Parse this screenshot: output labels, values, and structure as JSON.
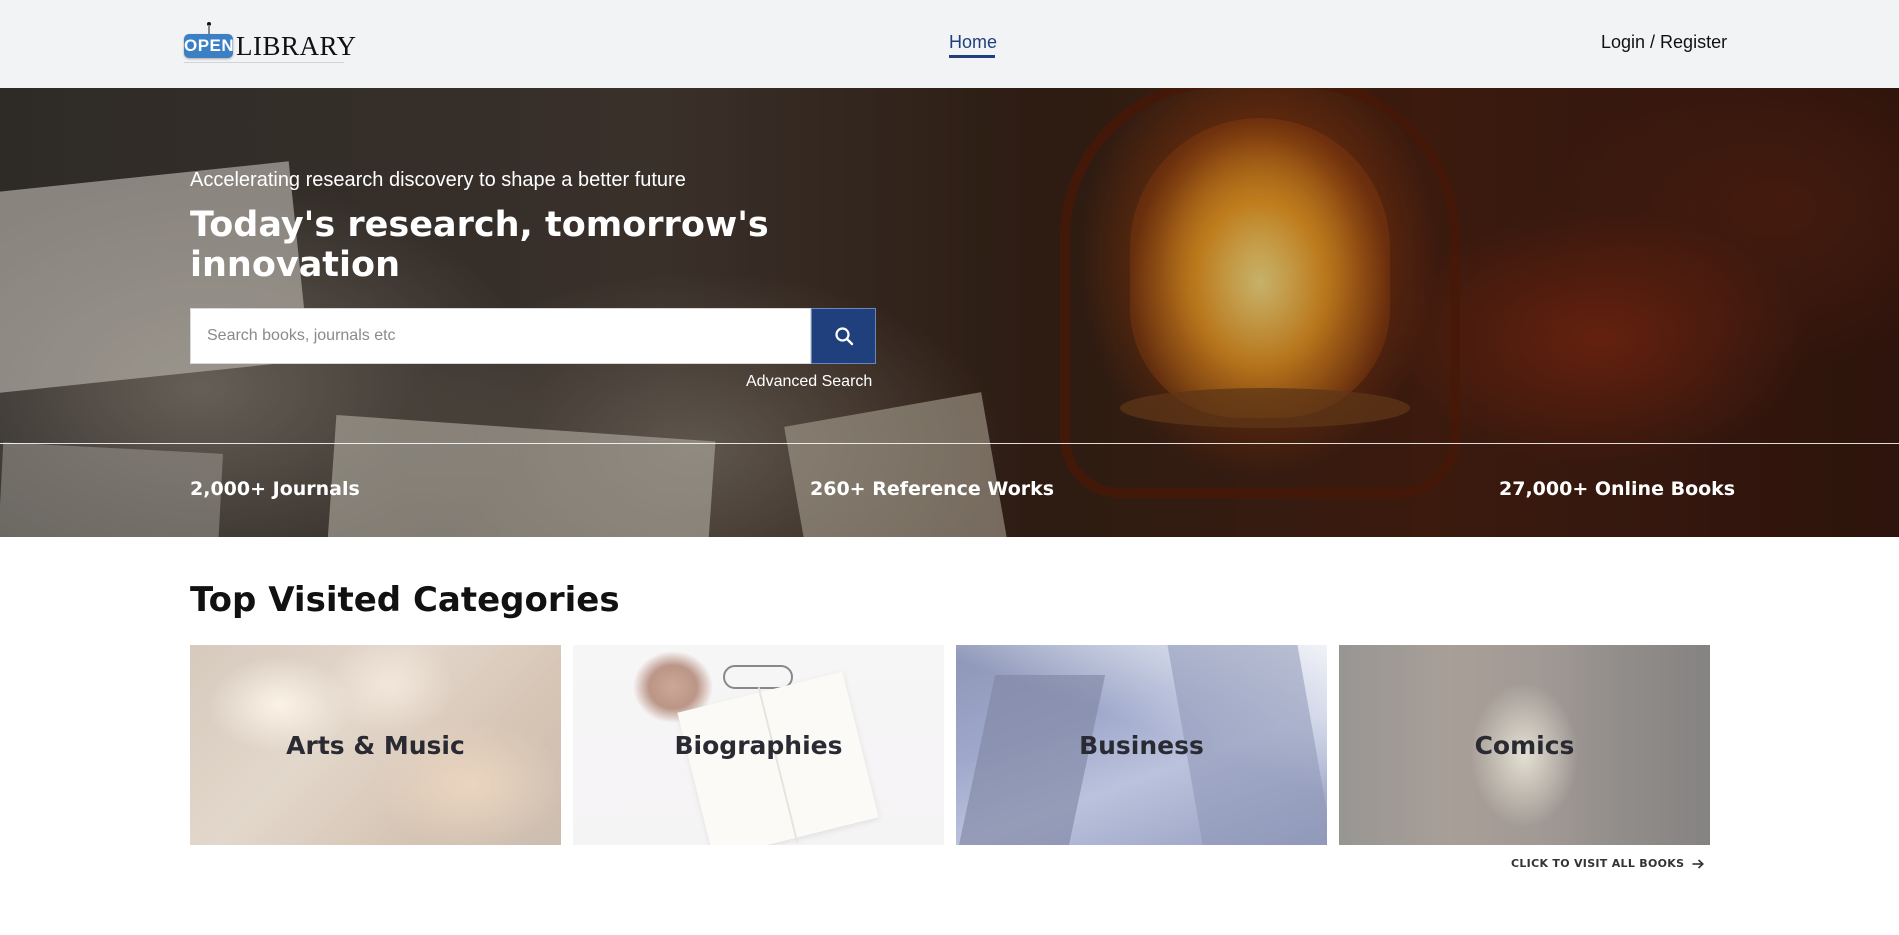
{
  "header": {
    "logo": {
      "badge_text": "OPEN",
      "word": "LIBRARY"
    },
    "nav": {
      "home_label": "Home",
      "login_label": "Login / Register"
    },
    "active_color": "#1f3f7d"
  },
  "hero": {
    "tagline": "Accelerating research discovery to shape a better future",
    "title": "Today's research, tomorrow's innovation",
    "search": {
      "placeholder": "Search books, journals etc",
      "value": "",
      "button_icon": "search-icon"
    },
    "advanced_search_label": "Advanced Search",
    "stats": [
      "2,000+ Journals",
      "260+ Reference Works",
      "27,000+ Online Books"
    ]
  },
  "categories": {
    "title": "Top Visited Categories",
    "items": [
      {
        "label": "Arts & Music"
      },
      {
        "label": "Biographies"
      },
      {
        "label": "Business"
      },
      {
        "label": "Comics"
      }
    ],
    "visit_all_label": "CLICK TO VISIT ALL BOOKS",
    "visit_all_icon": "arrow-right-icon"
  }
}
